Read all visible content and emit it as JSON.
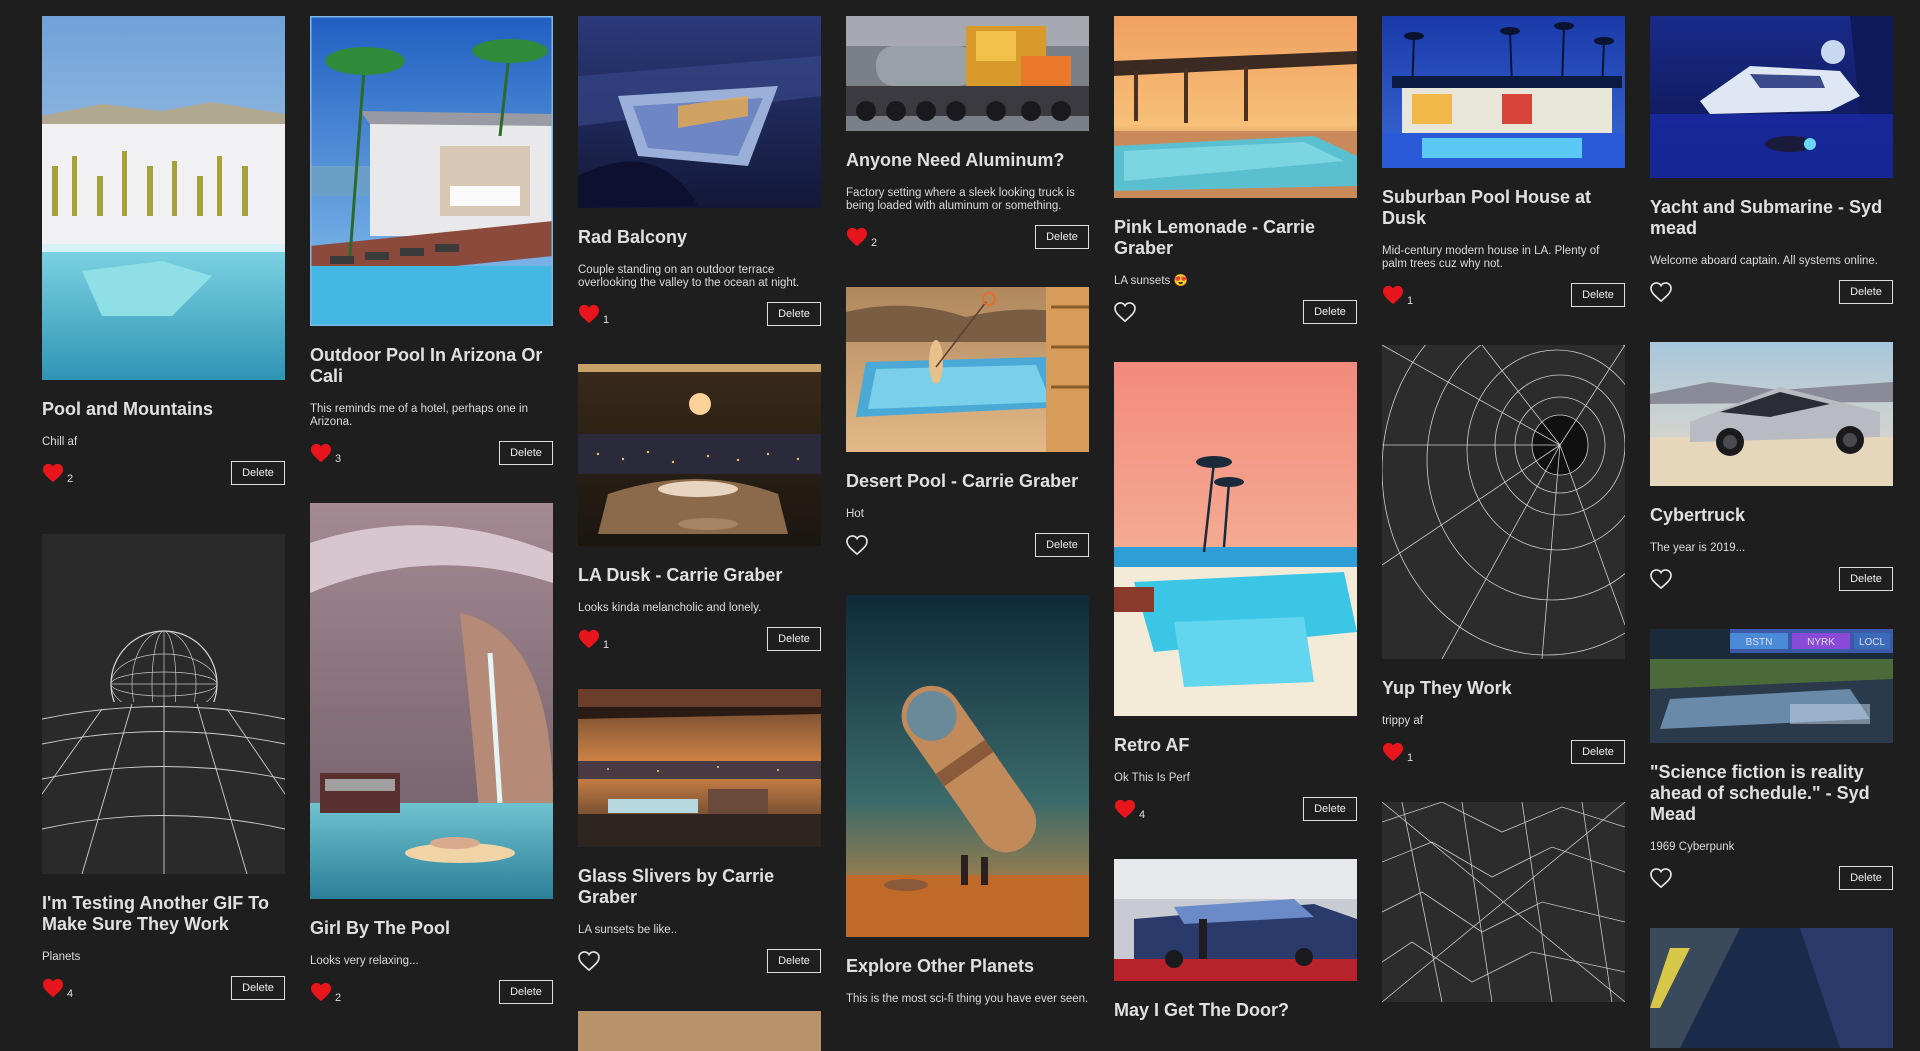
{
  "delete_label": "Delete",
  "cards": {
    "c1": {
      "title": "Pool and Mountains",
      "desc": "Chill af",
      "likes": "2"
    },
    "c2": {
      "title": "I'm Testing Another GIF To Make Sure They Work",
      "desc": "Planets",
      "likes": "4"
    },
    "c3": {
      "title": "Outdoor Pool In Arizona Or Cali",
      "desc": "This reminds me of a hotel, perhaps one in Arizona.",
      "likes": "3"
    },
    "c4": {
      "title": "Girl By The Pool",
      "desc": "Looks very relaxing...",
      "likes": "2"
    },
    "c5": {
      "title": "Rad Balcony",
      "desc": "Couple standing on an outdoor terrace overlooking the valley to the ocean at night.",
      "likes": "1"
    },
    "c6": {
      "title": "LA Dusk - Carrie Graber",
      "desc": "Looks kinda melancholic and lonely.",
      "likes": "1"
    },
    "c7": {
      "title": "Glass Slivers by Carrie Graber",
      "desc": "LA sunsets be like..",
      "likes": ""
    },
    "c8": {
      "title": "Anyone Need Aluminum?",
      "desc": "Factory setting where a sleek looking truck is being loaded with aluminum or something.",
      "likes": "2"
    },
    "c9": {
      "title": "Desert Pool - Carrie Graber",
      "desc": "Hot",
      "likes": ""
    },
    "c10": {
      "title": "Explore Other Planets",
      "desc": "This is the most sci-fi thing you have ever seen.",
      "likes": ""
    },
    "c11": {
      "title": "Pink Lemonade - Carrie Graber",
      "desc": "LA sunsets 😍",
      "likes": ""
    },
    "c12": {
      "title": "Retro AF",
      "desc": "Ok This Is Perf",
      "likes": "4"
    },
    "c13": {
      "title": "May I Get The Door?",
      "desc": "",
      "likes": ""
    },
    "c14": {
      "title": "Suburban Pool House at Dusk",
      "desc": "Mid-century modern house in LA. Plenty of palm trees cuz why not.",
      "likes": "1"
    },
    "c15": {
      "title": "Yup They Work",
      "desc": "trippy af",
      "likes": "1"
    },
    "c16": {
      "title": "Yacht and Submarine - Syd mead",
      "desc": "Welcome aboard captain. All systems online.",
      "likes": ""
    },
    "c17": {
      "title": "Cybertruck",
      "desc": "The year is 2019...",
      "likes": ""
    },
    "c18": {
      "title": "\"Science fiction is reality ahead of schedule.\" - Syd Mead",
      "desc": "1969 Cyberpunk",
      "likes": ""
    }
  },
  "image_signs": [
    "BSTN",
    "NYRK",
    "LOCL"
  ],
  "colors": {
    "background": "#1e1e1e",
    "heart_filled": "#e8161c",
    "heart_outline": "#e6e6e6"
  },
  "icons": {
    "liked": "heart-filled-icon",
    "not_liked": "heart-outline-icon"
  }
}
